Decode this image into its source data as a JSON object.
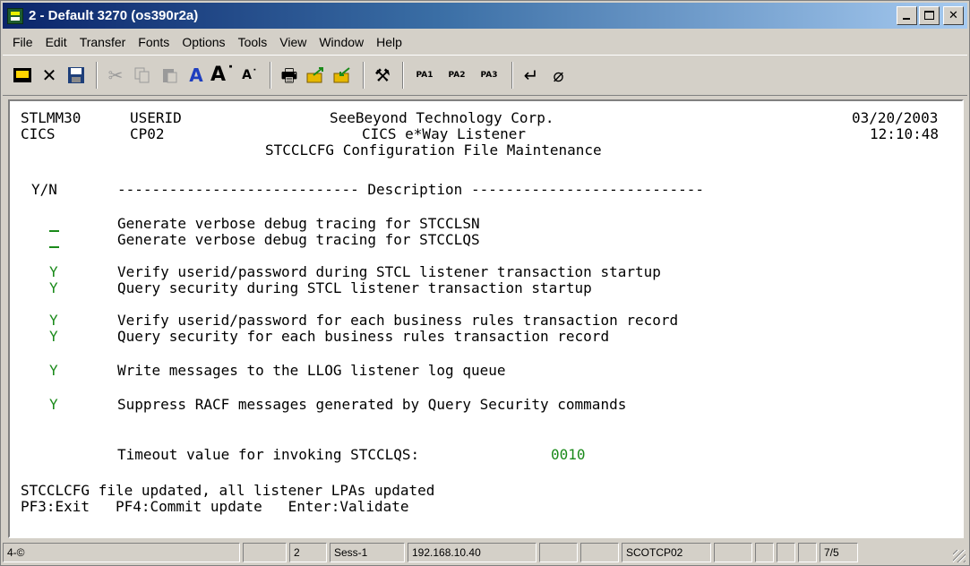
{
  "window": {
    "title": "2 - Default 3270 (os390r2a)"
  },
  "menu": [
    "File",
    "Edit",
    "Transfer",
    "Fonts",
    "Options",
    "Tools",
    "View",
    "Window",
    "Help"
  ],
  "toolbar": {
    "pa1": "PA1",
    "pa2": "PA2",
    "pa3": "PA3"
  },
  "terminal": {
    "header": {
      "system": "STLMM30",
      "userid_label": "USERID",
      "company": "SeeBeyond Technology Corp.",
      "date": "03/20/2003",
      "region": "CICS",
      "terminal_id": "CP02",
      "subtitle": "CICS e*Way Listener",
      "time": "12:10:48",
      "screen_title": "STCCLCFG Configuration File Maintenance"
    },
    "columns": {
      "yn": "Y/N",
      "description_rule": "---------------------------- Description ---------------------------"
    },
    "options": [
      {
        "value": "",
        "text": "Generate verbose debug tracing for STCCLSN"
      },
      {
        "value": "",
        "text": "Generate verbose debug tracing for STCCLQS"
      },
      {
        "value": "Y",
        "text": "Verify userid/password during STCL listener transaction startup"
      },
      {
        "value": "Y",
        "text": "Query security during STCL listener transaction startup"
      },
      {
        "value": "Y",
        "text": "Verify userid/password for each business rules transaction record"
      },
      {
        "value": "Y",
        "text": "Query security for each business rules transaction record"
      },
      {
        "value": "Y",
        "text": "Write messages to the LLOG listener log queue"
      },
      {
        "value": "Y",
        "text": "Suppress RACF messages generated by Query Security commands"
      }
    ],
    "timeout": {
      "label": "Timeout value for invoking STCCLQS:",
      "value": "0010"
    },
    "message": "STCCLCFG file updated, all listener LPAs updated",
    "pfkeys": "PF3:Exit   PF4:Commit update   Enter:Validate"
  },
  "status": {
    "mode": "4-©",
    "session_num": "2",
    "session": "Sess-1",
    "host": "192.168.10.40",
    "lu": "SCOTCP02",
    "cursor": "7/5"
  }
}
